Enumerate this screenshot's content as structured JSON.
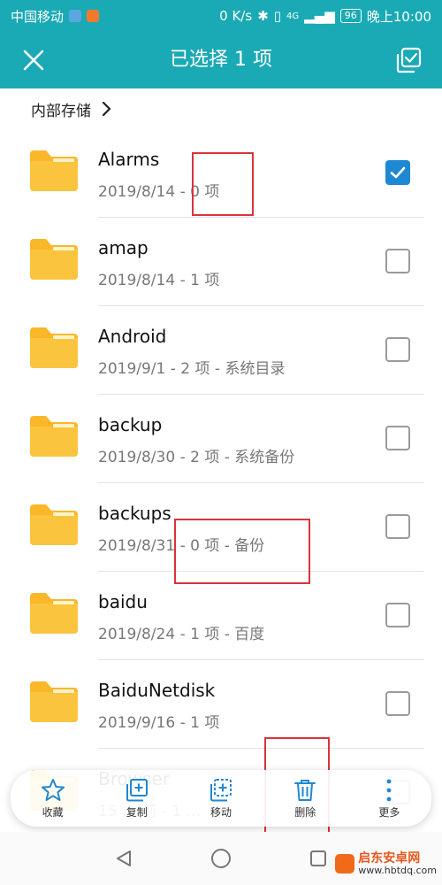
{
  "status_bar": {
    "carrier": "中国移动",
    "speed": "0 K/s",
    "network": "4G",
    "battery": "96",
    "time": "晚上10:00"
  },
  "app_bar": {
    "title": "已选择 1 项",
    "close_icon": "close-icon",
    "select_all_icon": "select-all-icon"
  },
  "breadcrumb": {
    "label": "内部存储"
  },
  "files": [
    {
      "name": "Alarms",
      "meta": "2019/8/14 - 0 项",
      "checked": true
    },
    {
      "name": "amap",
      "meta": "2019/8/14 - 1 项",
      "checked": false
    },
    {
      "name": "Android",
      "meta": "2019/9/1 - 2 项 - 系统目录",
      "checked": false
    },
    {
      "name": "backup",
      "meta": "2019/8/30 - 2 项 - 系统备份",
      "checked": false
    },
    {
      "name": "backups",
      "meta": "2019/8/31 - 0 项 - 备份",
      "checked": false
    },
    {
      "name": "baidu",
      "meta": "2019/8/24 - 1 项 - 百度",
      "checked": false
    },
    {
      "name": "BaiduNetdisk",
      "meta": "2019/9/16 - 1 项",
      "checked": false
    },
    {
      "name": "Browser",
      "meta": "15 … 前 - 1 …",
      "checked": false
    }
  ],
  "actions": {
    "favorite": "收藏",
    "copy": "复制",
    "move": "移动",
    "delete": "删除",
    "more": "更多"
  },
  "watermark": {
    "title": "启东安卓网",
    "url": "www.hbtdq.com"
  },
  "colors": {
    "header": "#1aaab5",
    "checkbox_active": "#1e88d2",
    "folder": "#f9b729",
    "annotation": "#d9343a",
    "action_icon": "#1e88d2"
  }
}
